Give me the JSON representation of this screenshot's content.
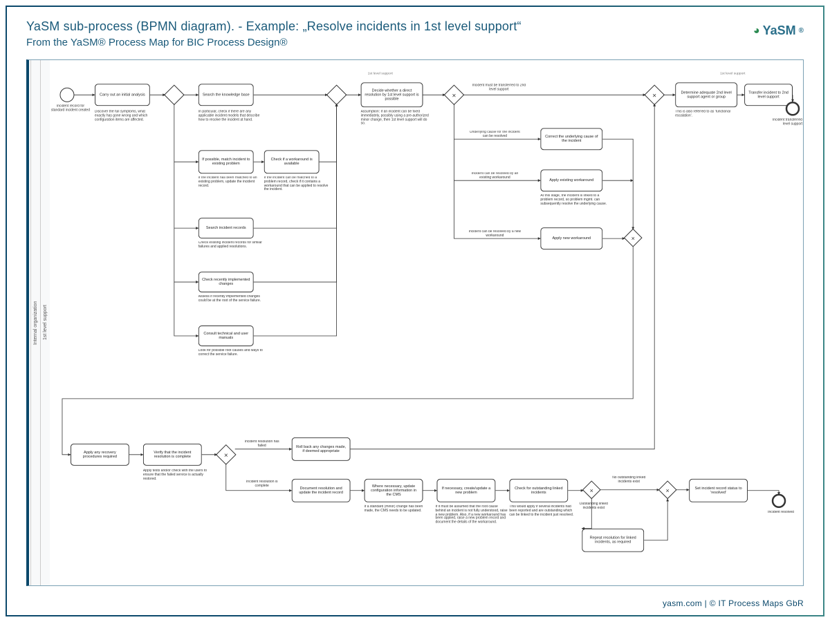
{
  "header": {
    "title": "YaSM sub-process (BPMN diagram). - Example: „Resolve incidents in 1st level support“",
    "subtitle": "From the YaSM® Process Map for BIC Process Design®",
    "brand": "YaSM",
    "brand_reg": "®"
  },
  "footer": "yasm.com | © IT Process Maps GbR",
  "pool": {
    "label_outer": "Internal organization",
    "label_inner": "1st level support",
    "header_top": "1st level support"
  },
  "events": {
    "start": {
      "label": "Incident record for standard incident created"
    },
    "end_transfer": {
      "label": "Incident transferred to 2nd level support"
    },
    "end_resolved": {
      "label": "Incident resolved"
    }
  },
  "gateways": {
    "g_after_analysis": "",
    "g_after_kb": "",
    "g_decide_path": "Incident must be transferred to 2nd level support",
    "g_merge_fix": "",
    "g_after_verify": "",
    "g_after_linked_check": "No outstanding linked incidents exist",
    "g_merge_resolve": ""
  },
  "gw_labels": {
    "transfer": "Incident must be transferred to 2nd level support",
    "underlying": "Underlying cause for the incident can be resolved",
    "existing_wa": "Incident can be resolved by an existing workaround",
    "new_wa": "Incident can be resolved by a new workaround",
    "res_failed": "Incident resolution has failed",
    "res_complete": "Incident resolution is complete",
    "linked_exist": "Outstanding linked incidents exist",
    "no_linked": "No outstanding linked incidents exist"
  },
  "tasks": {
    "t_analysis": "Carry out an initial analysis",
    "t_kb": "Search the knowledge base",
    "t_match_problem": "If possible, match incident to existing problem",
    "t_check_wa": "Check if a workaround is available",
    "t_search_inc": "Search incident records",
    "t_check_changes": "Check recently implemented changes",
    "t_manuals": "Consult technical and user manuals",
    "t_decide_direct": "Decide whether a direct resolution by 1st level support is possible",
    "t_correct_cause": "Correct the underlying cause of the incident",
    "t_apply_existing_wa": "Apply existing workaround",
    "t_apply_new_wa": "Apply new workaround",
    "t_determine_2nd": "Determine adequate 2nd level support agent or group",
    "t_transfer_2nd": "Transfer incident to 2nd level support",
    "t_apply_recovery": "Apply any recovery procedures required",
    "t_verify_complete": "Verify that the incident resolution is complete",
    "t_rollback": "Roll back any changes made, if deemed appropriate",
    "t_doc_update": "Document resolution and update the incident record",
    "t_update_cms": "Where necessary, update configuration information in the CMS",
    "t_raise_problem": "If necessary, create/update a new problem",
    "t_check_linked": "Check for outstanding linked incidents",
    "t_repeat_linked": "Repeat resolution for linked incidents, as required",
    "t_set_resolved": "Set incident record status to 'resolved'"
  },
  "annotations": {
    "a_analysis": "Discover the full symptoms, what exactly has gone wrong and which configuration items are affected.",
    "a_kb": "In particular, check if there are any applicable incident models that describe how to resolve the incident at hand.",
    "a_match_problem": "If the incident has been matched to an existing problem, update the incident record.",
    "a_check_wa": "If the incident can be matched to a problem record, check if it contains a workaround that can be applied to resolve the incident.",
    "a_search_inc": "Check existing incident records for similar failures and applied resolutions.",
    "a_check_changes": "Assess if recently implemented changes could be at the root of the service failure.",
    "a_manuals": "Look for possible root causes and ways to correct the service failure.",
    "a_decide_direct": "Assumption: If an incident can be fixed immediately, possibly using a pre-authorized minor change, then 1st level support will do so.",
    "a_apply_existing_wa": "At this stage, the incident is linked to a problem record, so problem mgmt. can subsequently resolve the underlying cause.",
    "a_determine_2nd": "This is also referred to as 'functional escalation'.",
    "a_verify_complete": "Apply tests and/or check with the users to ensure that the failed service is actually restored.",
    "a_update_cms": "If a standard (minor) change has been made, the CMS needs to be updated.",
    "a_raise_problem": "If it must be assumed that the root cause behind an incident is not fully understood, raise a new problem. Also, if a new workaround has been applied, raise a new problem record and document the details of the workaround.",
    "a_check_linked": "This would apply if several incidents had been reported and are outstanding which can be linked to the incident just resolved."
  }
}
